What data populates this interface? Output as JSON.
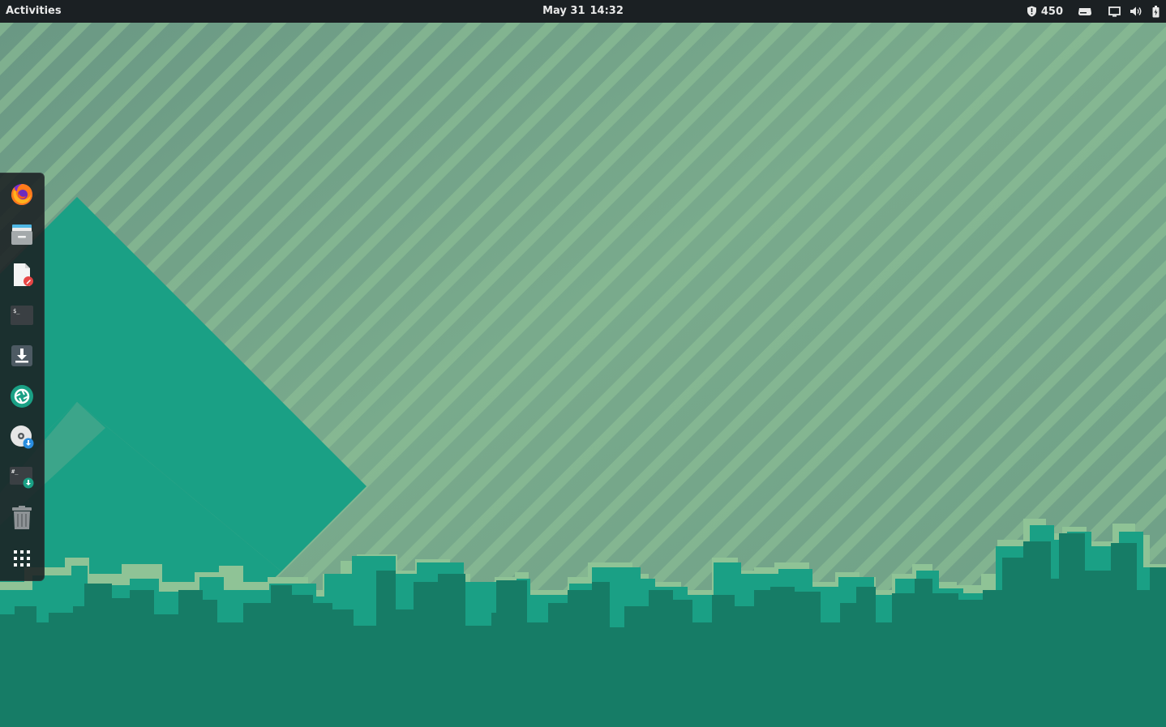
{
  "topbar": {
    "activities_label": "Activities",
    "date": "May 31",
    "time": "14:32",
    "tray": {
      "shield_icon": "shield-icon",
      "update_count": "450",
      "drive_icon": "drive-icon",
      "screen_icon": "display-icon",
      "volume_icon": "volume-icon",
      "battery_icon": "battery-icon"
    }
  },
  "dock": {
    "items": [
      {
        "name": "firefox",
        "icon": "firefox-icon"
      },
      {
        "name": "files",
        "icon": "file-manager-icon"
      },
      {
        "name": "text-editor",
        "icon": "text-editor-icon"
      },
      {
        "name": "terminal",
        "icon": "terminal-icon"
      },
      {
        "name": "software-installer",
        "icon": "download-icon"
      },
      {
        "name": "screenshot",
        "icon": "camera-shutter-icon"
      },
      {
        "name": "disk-writer",
        "icon": "disc-download-icon"
      },
      {
        "name": "root-terminal",
        "icon": "terminal-download-icon"
      },
      {
        "name": "trash",
        "icon": "trash-icon"
      },
      {
        "name": "show-applications",
        "icon": "app-grid-icon"
      }
    ]
  },
  "colors": {
    "topbar_bg": "#1b2023",
    "wallpaper_base": "#6f9e88",
    "accent_teal": "#1aa085",
    "city_dark": "#167c66",
    "stripe_light": "#8fc396"
  }
}
